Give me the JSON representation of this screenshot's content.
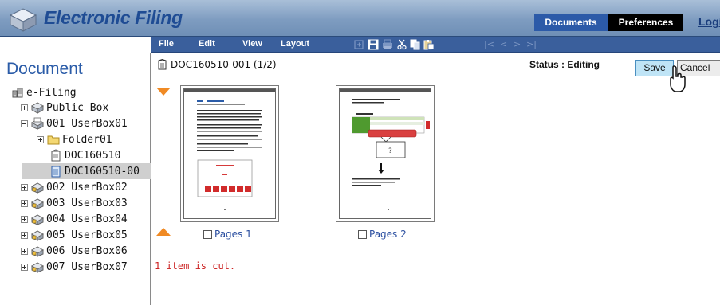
{
  "app": {
    "title": "Electronic Filing",
    "tabs": [
      {
        "label": "Documents",
        "active": true
      },
      {
        "label": "Preferences",
        "active": false
      }
    ],
    "login_label": "Logi"
  },
  "menubar": {
    "items": [
      "File",
      "Edit",
      "View",
      "Layout"
    ],
    "toolbar_icons": [
      "insert-page-icon",
      "save-disk-icon",
      "print-icon",
      "cut-icon",
      "copy-icon",
      "paste-icon"
    ],
    "nav_symbols": [
      "|<",
      "<",
      ">",
      ">|"
    ]
  },
  "sidebar": {
    "title": "Document",
    "tree": [
      {
        "label": "e-Filing",
        "icon": "efiling-root-icon",
        "expander": "none",
        "indent": 0
      },
      {
        "label": "Public Box",
        "icon": "public-box-icon",
        "expander": "plus",
        "indent": 1
      },
      {
        "label": "001 UserBox01",
        "icon": "user-box-open-icon",
        "expander": "minus",
        "indent": 1
      },
      {
        "label": "Folder01",
        "icon": "folder-icon",
        "expander": "plus",
        "indent": 2
      },
      {
        "label": "DOC160510",
        "icon": "document-icon",
        "expander": "none",
        "indent": 3
      },
      {
        "label": "DOC160510-00",
        "icon": "document-editing-icon",
        "expander": "none",
        "indent": 3,
        "selected": true
      },
      {
        "label": "002 UserBox02",
        "icon": "user-box-icon",
        "expander": "plus",
        "indent": 1
      },
      {
        "label": "003 UserBox03",
        "icon": "user-box-icon",
        "expander": "plus",
        "indent": 1
      },
      {
        "label": "004 UserBox04",
        "icon": "user-box-icon",
        "expander": "plus",
        "indent": 1
      },
      {
        "label": "005 UserBox05",
        "icon": "user-box-icon",
        "expander": "plus",
        "indent": 1
      },
      {
        "label": "006 UserBox06",
        "icon": "user-box-icon",
        "expander": "plus",
        "indent": 1
      },
      {
        "label": "007 UserBox07",
        "icon": "user-box-icon",
        "expander": "plus",
        "indent": 1
      }
    ]
  },
  "main": {
    "document_name": "DOC160510-001 (1/2)",
    "status": "Status : Editing",
    "save_label": "Save",
    "cancel_label": "Cancel",
    "pages": [
      {
        "label": "Pages 1",
        "checked": false
      },
      {
        "label": "Pages 2",
        "checked": false
      }
    ],
    "message": "1 item is cut."
  },
  "colors": {
    "header_blue": "#7e9cc0",
    "menubar_blue": "#3a5f9c",
    "title_blue": "#1f4c94",
    "accent_orange": "#f08a24",
    "cut_red": "#cc2222",
    "save_button": "#bfe4f6"
  }
}
